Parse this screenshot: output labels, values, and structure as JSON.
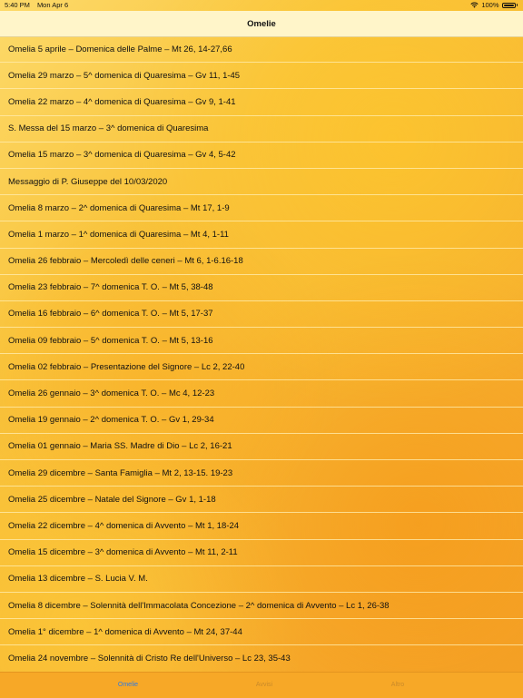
{
  "status": {
    "time": "5:40 PM",
    "date": "Mon Apr 6",
    "battery": "100%"
  },
  "nav": {
    "title": "Omelie"
  },
  "items": [
    "Omelia 5 aprile – Domenica delle Palme – Mt 26, 14-27,66",
    "Omelia 29 marzo – 5^ domenica di Quaresima – Gv 11, 1-45",
    "Omelia 22 marzo – 4^ domenica di Quaresima – Gv 9, 1-41",
    "S. Messa del 15 marzo – 3^ domenica di Quaresima",
    "Omelia 15 marzo – 3^ domenica di Quaresima – Gv 4, 5-42",
    "Messaggio di P. Giuseppe del 10/03/2020",
    "Omelia 8 marzo – 2^ domenica di Quaresima – Mt 17, 1-9",
    "Omelia 1 marzo – 1^ domenica di Quaresima – Mt 4, 1-11",
    "Omelia 26 febbraio – Mercoledì delle ceneri – Mt 6, 1-6.16-18",
    "Omelia 23 febbraio – 7^ domenica T. O. – Mt 5, 38-48",
    "Omelia 16 febbraio – 6^ domenica T. O. – Mt 5, 17-37",
    "Omelia 09 febbraio – 5^ domenica T. O. – Mt 5, 13-16",
    "Omelia 02 febbraio – Presentazione del Signore – Lc 2, 22-40",
    "Omelia 26 gennaio – 3^ domenica T. O. – Mc 4, 12-23",
    "Omelia 19 gennaio – 2^ domenica T. O. – Gv 1, 29-34",
    "Omelia 01 gennaio – Maria SS. Madre di Dio – Lc 2, 16-21",
    "Omelia 29 dicembre – Santa Famiglia – Mt 2, 13-15. 19-23",
    "Omelia 25 dicembre – Natale del Signore – Gv 1, 1-18",
    "Omelia 22 dicembre – 4^ domenica di Avvento – Mt 1, 18-24",
    "Omelia 15 dicembre – 3^ domenica di Avvento – Mt 11, 2-11",
    "Omelia 13 dicembre – S. Lucia V. M.",
    "Omelia 8 dicembre – Solennità dell'Immacolata Concezione – 2^ domenica di Avvento – Lc 1, 26-38",
    "Omelia 1° dicembre – 1^ domenica di Avvento – Mt 24, 37-44",
    "Omelia 24 novembre – Solennità di Cristo Re dell'Universo – Lc 23, 35-43"
  ],
  "tabs": [
    {
      "label": "Omelie",
      "active": true
    },
    {
      "label": "Avvisi",
      "active": false
    },
    {
      "label": "Altro",
      "active": false
    }
  ]
}
